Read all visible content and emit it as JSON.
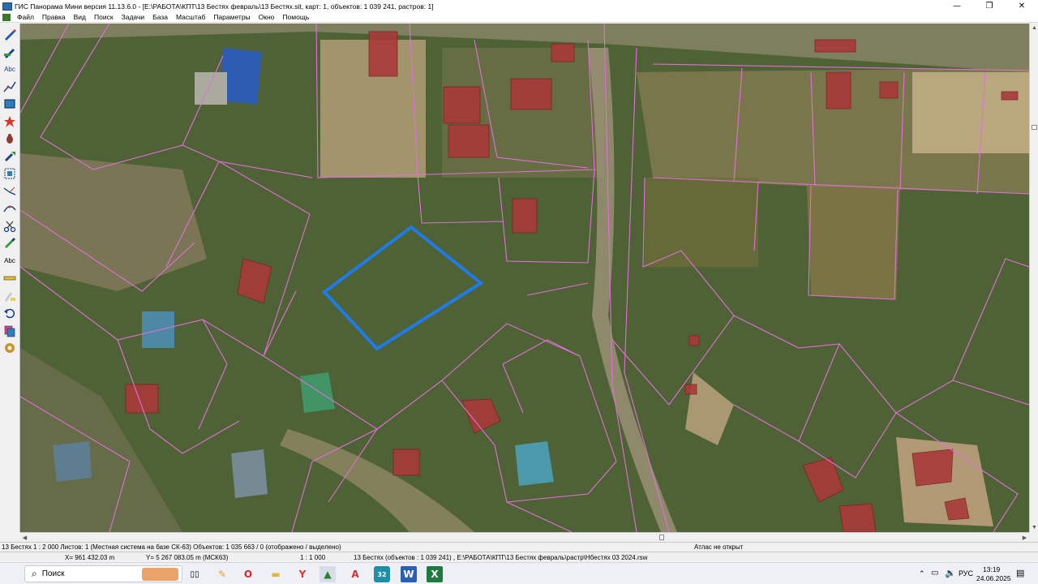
{
  "window": {
    "title": "ГИС Панорама Мини версия 11.13.6.0 - [E:\\РАБОТА\\КПТ\\13 Бестях февраль\\13 Бестях.sit, карт: 1, объектов: 1 039 241, растров: 1]",
    "min_icon": "—",
    "restore_icon": "❐",
    "close_icon": "✕"
  },
  "menu": [
    "Файл",
    "Правка",
    "Вид",
    "Поиск",
    "Задачи",
    "База",
    "Масштаб",
    "Параметры",
    "Окно",
    "Помощь"
  ],
  "toolbar": {
    "tools": [
      "pen-icon",
      "pen-ruler-icon",
      "text-abc-icon",
      "polyline-icon",
      "rectangle-select-icon",
      "star-object-icon",
      "bug-icon",
      "move-arrow-icon",
      "select-frame-icon",
      "split-line-icon",
      "curve-icon",
      "scissors-icon",
      "paint-icon",
      "text-abc-icon-2",
      "ruler-icon",
      "edit-layers-icon",
      "undo-icon",
      "copy-icon",
      "settings-gear-icon"
    ],
    "abc_label": "Abc"
  },
  "status": {
    "scale_info": "13 Бестях   1 : 2 000  Листов: 1   (Местная система на базе СК-63)  Объектов: 1 035 663 / 0 (отображено / выделено)",
    "atlas": "Атлас не открыт",
    "x_coord": "X=   961 432.03 m",
    "y_coord": "Y= 5 267 083.05 m   (МСК63)",
    "scale2": "1 : 1 000",
    "raster_info": "13 Бестях   (объектов : 1 039 241) , E:\\РАБОТА\\КПТ\\13 Бестях февраль\\растр\\Нбестях 03 2024.rsw"
  },
  "taskbar": {
    "search_placeholder": "Поиск",
    "lang": "РУС",
    "time": "13:19",
    "date": "24.06.2025",
    "apps": [
      "taskview-icon",
      "paint-brush-icon",
      "opera-icon",
      "file-manager-icon",
      "yandex-icon",
      "gis-panorama-icon",
      "acrobat-icon",
      "32-app-icon",
      "word-icon",
      "excel-icon"
    ]
  },
  "colors": {
    "parcel_line": "#e070d8",
    "selected_parcel": "#1e7be8",
    "building_fill": "#a83a3a",
    "map_vegetation": "#4f6236"
  }
}
